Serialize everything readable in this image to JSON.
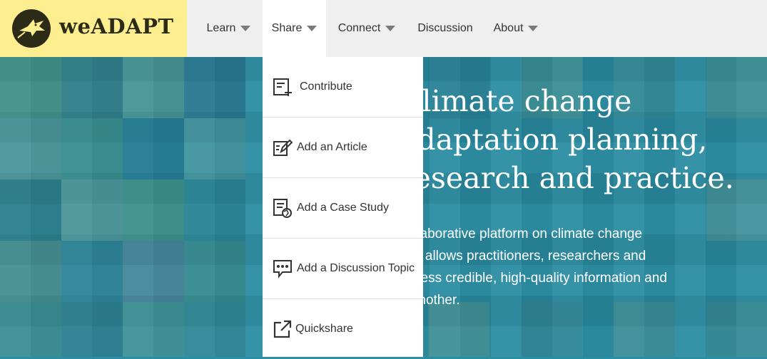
{
  "brand": {
    "name": "weADAPT"
  },
  "nav": [
    {
      "label": "Learn",
      "has_caret": true
    },
    {
      "label": "Share",
      "has_caret": true,
      "active": true
    },
    {
      "label": "Connect",
      "has_caret": true
    },
    {
      "label": "Discussion",
      "has_caret": false
    },
    {
      "label": "About",
      "has_caret": true
    }
  ],
  "share_menu": [
    {
      "label": "Contribute",
      "icon": "contribute-icon"
    },
    {
      "label": "Add an Article",
      "icon": "edit-article-icon"
    },
    {
      "label": "Add a Case Study",
      "icon": "case-study-icon"
    },
    {
      "label": "Add a Discussion Topic",
      "icon": "discussion-icon"
    },
    {
      "label": "Quickshare",
      "icon": "external-link-icon"
    }
  ],
  "hero": {
    "headline": [
      "Climate change",
      "adaptation planning,",
      "research and practice."
    ],
    "description": [
      "collaborative platform on climate change",
      "s. It allows practitioners, researchers and",
      "access credible, high-quality information and",
      "e another."
    ]
  },
  "colors": {
    "logo_bg": "#fdee8f",
    "nav_bg": "#efefef",
    "hero_tint": "#2a8fa5",
    "text_dark": "#333333"
  }
}
